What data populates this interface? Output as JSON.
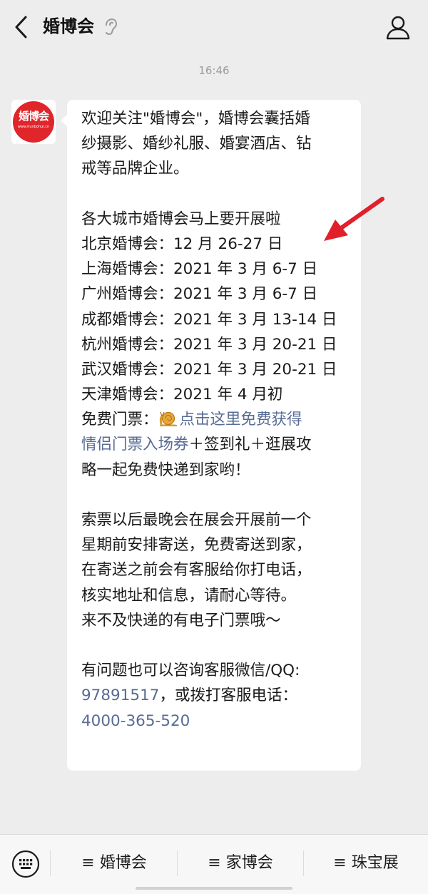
{
  "header": {
    "title": "婚博会",
    "icons": {
      "back": "back-chevron-icon",
      "ear": "ear-icon",
      "profile": "person-icon"
    }
  },
  "chat": {
    "timestamp": "16:46",
    "avatar": {
      "logo_text": "婚博会",
      "logo_sub": "www.hunbohui.cn",
      "brand_color": "#e0252b"
    },
    "message": {
      "intro": [
        "欢迎关注\"婚博会\"，婚博会囊括婚",
        "纱摄影、婚纱礼服、婚宴酒店、钻",
        "戒等品牌企业。"
      ],
      "cities_title": "各大城市婚博会马上要开展啦",
      "cities": [
        "北京婚博会：12 月 26-27 日",
        "上海婚博会：2021 年 3 月 6-7 日",
        "广州婚博会：2021 年 3 月 6-7 日",
        "成都婚博会：2021 年 3 月 13-14 日",
        "杭州婚博会：2021 年 3 月 20-21 日",
        "武汉婚博会：2021 年 3 月 20-21 日",
        "天津婚博会：2021 年 4 月初"
      ],
      "ticket": {
        "prefix": "免费门票：",
        "link_part1": "点击这里免费获得",
        "link_part2": "情侣门票入场券",
        "suffix1": "＋签到礼＋逛展攻",
        "suffix2": "略一起免费快递到家哟！"
      },
      "delivery": [
        "索票以后最晚会在展会开展前一个",
        "星期前安排寄送，免费寄送到家，",
        "在寄送之前会有客服给你打电话，",
        "核实地址和信息，请耐心等待。",
        "来不及快递的有电子门票哦～"
      ],
      "contact": {
        "line1": "有问题也可以咨询客服微信/QQ:",
        "qq": "97891517",
        "mid": "，或拨打客服电话：",
        "phone": "4000-365-520"
      },
      "link_color": "#576b95"
    },
    "annotation": {
      "icon": "red-arrow-icon",
      "color": "#e0202a"
    }
  },
  "bottom_menu": {
    "keyboard_icon": "keyboard-icon",
    "items": [
      {
        "label": "≡ 婚博会"
      },
      {
        "label": "≡ 家博会"
      },
      {
        "label": "≡ 珠宝展"
      }
    ]
  }
}
